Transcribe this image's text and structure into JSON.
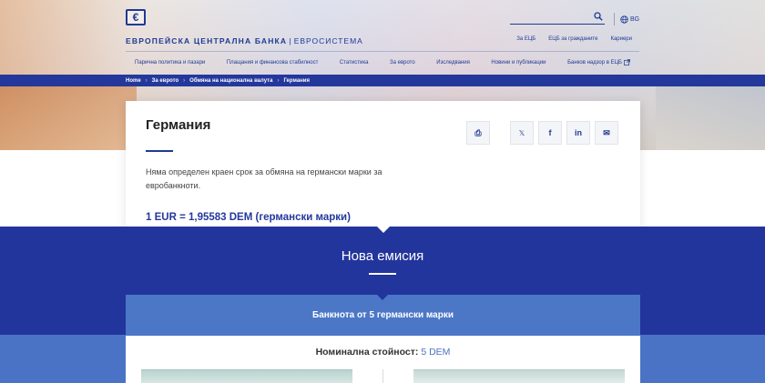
{
  "header": {
    "logo_glyph": "€",
    "org_name": "ЕВРОПЕЙСКА ЦЕНТРАЛНА БАНКА",
    "org_separator": "|",
    "org_sub": "ЕВРОСИСТЕМА",
    "search_placeholder": "",
    "language": "BG",
    "utility_links": [
      "За ЕЦБ",
      "ЕЦБ за гражданите",
      "Кариери"
    ],
    "nav_items": [
      "Парична политика и пазари",
      "Плащания и финансова стабилност",
      "Статистика",
      "За еврото",
      "Изследвания",
      "Новини и публикации",
      "Банков надзор в ЕЦБ"
    ]
  },
  "breadcrumb": {
    "items": [
      "Home",
      "За еврото",
      "Обмяна на национална валута",
      "Германия"
    ],
    "separator": "›"
  },
  "content": {
    "title": "Германия",
    "lead": "Няма определен краен срок за обмяна на германски марки за евробанкноти.",
    "rate": "1 EUR = 1,95583 DEM (германски марки)",
    "share_buttons": [
      {
        "icon": "print-icon",
        "glyph": "⎙"
      },
      {
        "icon": "x-icon",
        "glyph": "𝕏"
      },
      {
        "icon": "facebook-icon",
        "glyph": "f"
      },
      {
        "icon": "linkedin-icon",
        "glyph": "in"
      },
      {
        "icon": "email-icon",
        "glyph": "✉"
      }
    ]
  },
  "issue": {
    "title": "Нова емисия",
    "banknote_tab": "Банкнота от 5 германски марки",
    "denomination_label": "Номинална стойност:",
    "denomination_value": "5 DEM"
  },
  "colors": {
    "brand_blue": "#1f3a93",
    "section_blue": "#22359c",
    "tab_blue": "#4c77c7"
  }
}
